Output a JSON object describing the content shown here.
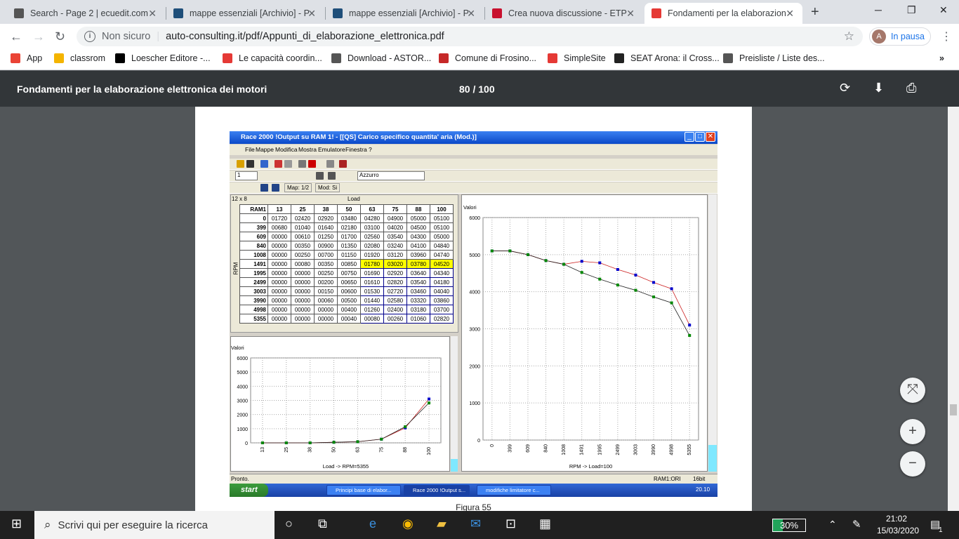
{
  "browser": {
    "tabs": [
      {
        "title": "Search - Page 2 | ecuedit.com",
        "favicon": "#555555"
      },
      {
        "title": "mappe essenziali [Archivio] - P",
        "favicon": "#1f4f7a"
      },
      {
        "title": "mappe essenziali [Archivio] - P",
        "favicon": "#1f4f7a"
      },
      {
        "title": "Crea nuova discussione - ETP S",
        "favicon": "#c8102e"
      },
      {
        "title": "Fondamenti per la elaborazion",
        "favicon": "#e53935"
      }
    ],
    "url_security": "Non sicuro",
    "url": "auto-consulting.it/pdf/Appunti_di_elaborazione_elettronica.pdf",
    "profile_initial": "A",
    "profile_status": "In pausa",
    "bookmarks": [
      {
        "label": "App",
        "color": "#ea4335"
      },
      {
        "label": "classrom",
        "color": "#f4b400"
      },
      {
        "label": "Loescher Editore -...",
        "color": "#000000"
      },
      {
        "label": "Le capacità coordin...",
        "color": "#e53935"
      },
      {
        "label": "Download - ASTOR...",
        "color": "#555555"
      },
      {
        "label": "Comune di Frosino...",
        "color": "#c62828"
      },
      {
        "label": "SimpleSite",
        "color": "#e53935"
      },
      {
        "label": "SEAT Arona: il Cross...",
        "color": "#222222"
      },
      {
        "label": "Preisliste / Liste des...",
        "color": "#555555"
      }
    ]
  },
  "pdf": {
    "title": "Fondamenti per la elaborazione elettronica dei motori",
    "page_indicator": "80 / 100",
    "caption": "Figura 55"
  },
  "app": {
    "title": "Race 2000 !Output su RAM 1! - [[QS] Carico specifico quantita' aria (Mod.)]",
    "menus": [
      "File",
      "Mappe",
      "Modifica",
      "Mostra",
      "Emulatore",
      "Finestra",
      "?"
    ],
    "field_value": "1",
    "color_select": "Azzurro",
    "map_label": "Map: 1/2",
    "mod_label": "Mod: Si",
    "grid_size": "12 x 8",
    "load_label": "Load",
    "rpm_label": "RPM",
    "corner": "RAM1",
    "status_left": "Pronto.",
    "status_mid": "RAM1:ORI",
    "status_right": "16bit",
    "start_label": "start",
    "tasks": [
      "Principi base di elabor...",
      "Race 2000 !Output s...",
      "modifiche limitatore c..."
    ],
    "tray_time": "20.10"
  },
  "map_table": {
    "load": [
      13,
      25,
      38,
      50,
      63,
      75,
      88,
      100
    ],
    "rows": [
      {
        "rpm": "0",
        "vals": [
          "01720",
          "02420",
          "02920",
          "03480",
          "04280",
          "04900",
          "05000",
          "05100"
        ]
      },
      {
        "rpm": "399",
        "vals": [
          "00680",
          "01040",
          "01640",
          "02180",
          "03100",
          "04020",
          "04500",
          "05100"
        ]
      },
      {
        "rpm": "609",
        "vals": [
          "00000",
          "00610",
          "01250",
          "01700",
          "02560",
          "03540",
          "04300",
          "05000"
        ]
      },
      {
        "rpm": "840",
        "vals": [
          "00000",
          "00350",
          "00900",
          "01350",
          "02080",
          "03240",
          "04100",
          "04840"
        ]
      },
      {
        "rpm": "1008",
        "vals": [
          "00000",
          "00250",
          "00700",
          "01150",
          "01920",
          "03120",
          "03960",
          "04740"
        ]
      },
      {
        "rpm": "1491",
        "vals": [
          "00000",
          "00080",
          "00350",
          "00850",
          "01780",
          "03020",
          "03780",
          "04520"
        ]
      },
      {
        "rpm": "1995",
        "vals": [
          "00000",
          "00000",
          "00250",
          "00750",
          "01690",
          "02920",
          "03640",
          "04340"
        ]
      },
      {
        "rpm": "2499",
        "vals": [
          "00000",
          "00000",
          "00200",
          "00650",
          "01610",
          "02820",
          "03540",
          "04180"
        ]
      },
      {
        "rpm": "3003",
        "vals": [
          "00000",
          "00000",
          "00150",
          "00600",
          "01530",
          "02720",
          "03460",
          "04040"
        ]
      },
      {
        "rpm": "3990",
        "vals": [
          "00000",
          "00000",
          "00060",
          "00500",
          "01440",
          "02580",
          "03320",
          "03860"
        ]
      },
      {
        "rpm": "4998",
        "vals": [
          "00000",
          "00000",
          "00000",
          "00400",
          "01260",
          "02400",
          "03180",
          "03700"
        ]
      },
      {
        "rpm": "5355",
        "vals": [
          "00000",
          "00000",
          "00000",
          "00040",
          "00080",
          "00260",
          "01060",
          "02820"
        ]
      }
    ]
  },
  "chart_data": [
    {
      "type": "line",
      "title": "Valori",
      "xlabel": "Load -> RPM=5355",
      "categories": [
        "13",
        "25",
        "38",
        "50",
        "63",
        "75",
        "88",
        "100"
      ],
      "ylim": [
        0,
        6000
      ],
      "yticks": [
        0,
        1000,
        2000,
        3000,
        4000,
        5000,
        6000
      ],
      "series": [
        {
          "color": "#0000cc",
          "values": [
            0,
            0,
            0,
            40,
            80,
            260,
            1060,
            3100
          ]
        },
        {
          "color": "#008800",
          "values": [
            0,
            0,
            0,
            40,
            80,
            260,
            1140,
            2820
          ]
        }
      ],
      "grid": true
    },
    {
      "type": "line",
      "title": "Valori",
      "xlabel": "RPM -> Load=100",
      "categories": [
        "0",
        "399",
        "609",
        "840",
        "1008",
        "1491",
        "1995",
        "2499",
        "3003",
        "3990",
        "4998",
        "5355"
      ],
      "ylim": [
        0,
        6000
      ],
      "yticks": [
        0,
        1000,
        2000,
        3000,
        4000,
        5000,
        6000
      ],
      "series": [
        {
          "color": "#0000cc",
          "values": [
            5100,
            5100,
            5000,
            4840,
            4740,
            4820,
            4780,
            4600,
            4450,
            4250,
            4080,
            3100
          ]
        },
        {
          "color": "#008800",
          "values": [
            5100,
            5100,
            5000,
            4840,
            4740,
            4520,
            4340,
            4180,
            4040,
            3860,
            3700,
            2820
          ]
        }
      ],
      "grid": true
    }
  ],
  "windows": {
    "search_placeholder": "Scrivi qui per eseguire la ricerca",
    "battery": "30%",
    "battery_level": 0.3,
    "time": "21:02",
    "date": "15/03/2020",
    "notifications": "1"
  }
}
